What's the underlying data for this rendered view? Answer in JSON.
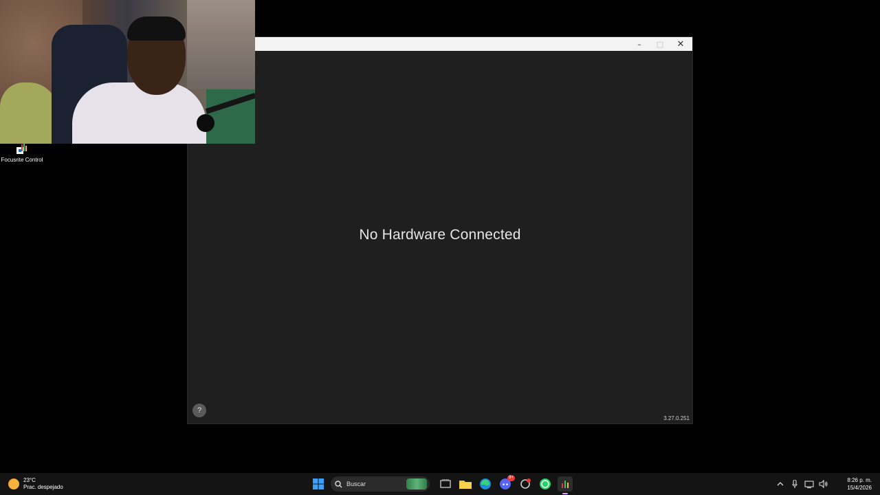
{
  "desktop": {
    "icons": [
      {
        "label": "Focusrite Control",
        "icon": "focusrite-icon"
      }
    ]
  },
  "window": {
    "controls": {
      "minimize": "–",
      "maximize": "□",
      "close": "✕"
    },
    "message": "No Hardware Connected",
    "help_label": "?",
    "version": "3.27.0.251"
  },
  "taskbar": {
    "weather": {
      "temp": "23°C",
      "condition": "Prac. despejado"
    },
    "search_placeholder": "Buscar",
    "apps": [
      "start",
      "search",
      "task-view",
      "file-explorer",
      "edge",
      "discord",
      "app-red-badge",
      "whatsapp",
      "focusrite-control"
    ],
    "discord_badge": "9+",
    "clock": {
      "time": "8:26 p. m.",
      "date": "15/4/2026"
    },
    "accent": "#d7a6ff"
  }
}
